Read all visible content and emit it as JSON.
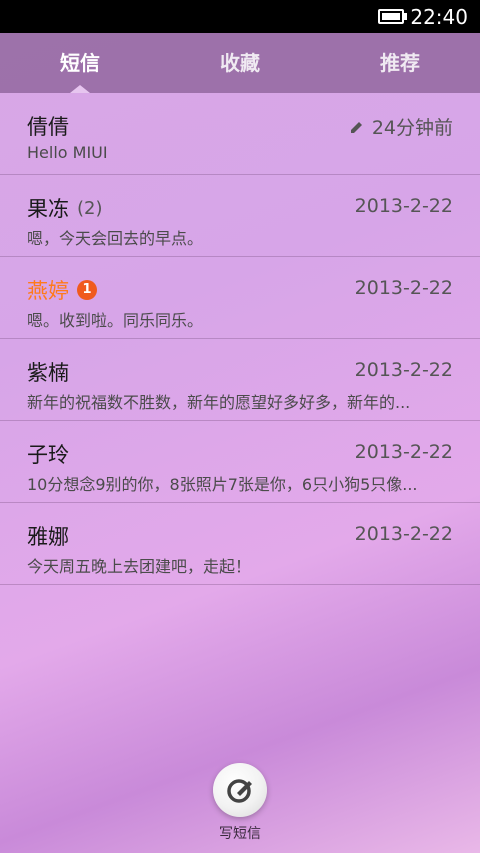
{
  "status": {
    "time": "22:40"
  },
  "tabs": [
    {
      "label": "短信",
      "active": true
    },
    {
      "label": "收藏",
      "active": false
    },
    {
      "label": "推荐",
      "active": false
    }
  ],
  "messages": [
    {
      "name": "倩倩",
      "count": "",
      "badge": "",
      "time": "24分钟前",
      "preview": "Hello MIUI",
      "draft": true,
      "unread": false
    },
    {
      "name": "果冻",
      "count": "(2)",
      "badge": "",
      "time": "2013-2-22",
      "preview": "嗯，今天会回去的早点。",
      "draft": false,
      "unread": false
    },
    {
      "name": "燕婷",
      "count": "",
      "badge": "1",
      "time": "2013-2-22",
      "preview": "嗯。收到啦。同乐同乐。",
      "draft": false,
      "unread": true
    },
    {
      "name": "紫楠",
      "count": "",
      "badge": "",
      "time": "2013-2-22",
      "preview": "新年的祝福数不胜数，新年的愿望好多好多，新年的...",
      "draft": false,
      "unread": false
    },
    {
      "name": "子玲",
      "count": "",
      "badge": "",
      "time": "2013-2-22",
      "preview": "10分想念9别的你，8张照片7张是你，6只小狗5只像...",
      "draft": false,
      "unread": false
    },
    {
      "name": "雅娜",
      "count": "",
      "badge": "",
      "time": "2013-2-22",
      "preview": "今天周五晚上去团建吧，走起！",
      "draft": false,
      "unread": false
    }
  ],
  "compose": {
    "label": "写短信",
    "icon": "compose-icon"
  },
  "colors": {
    "unread_name": "#ff7a1a",
    "badge": "#f05a1e"
  }
}
